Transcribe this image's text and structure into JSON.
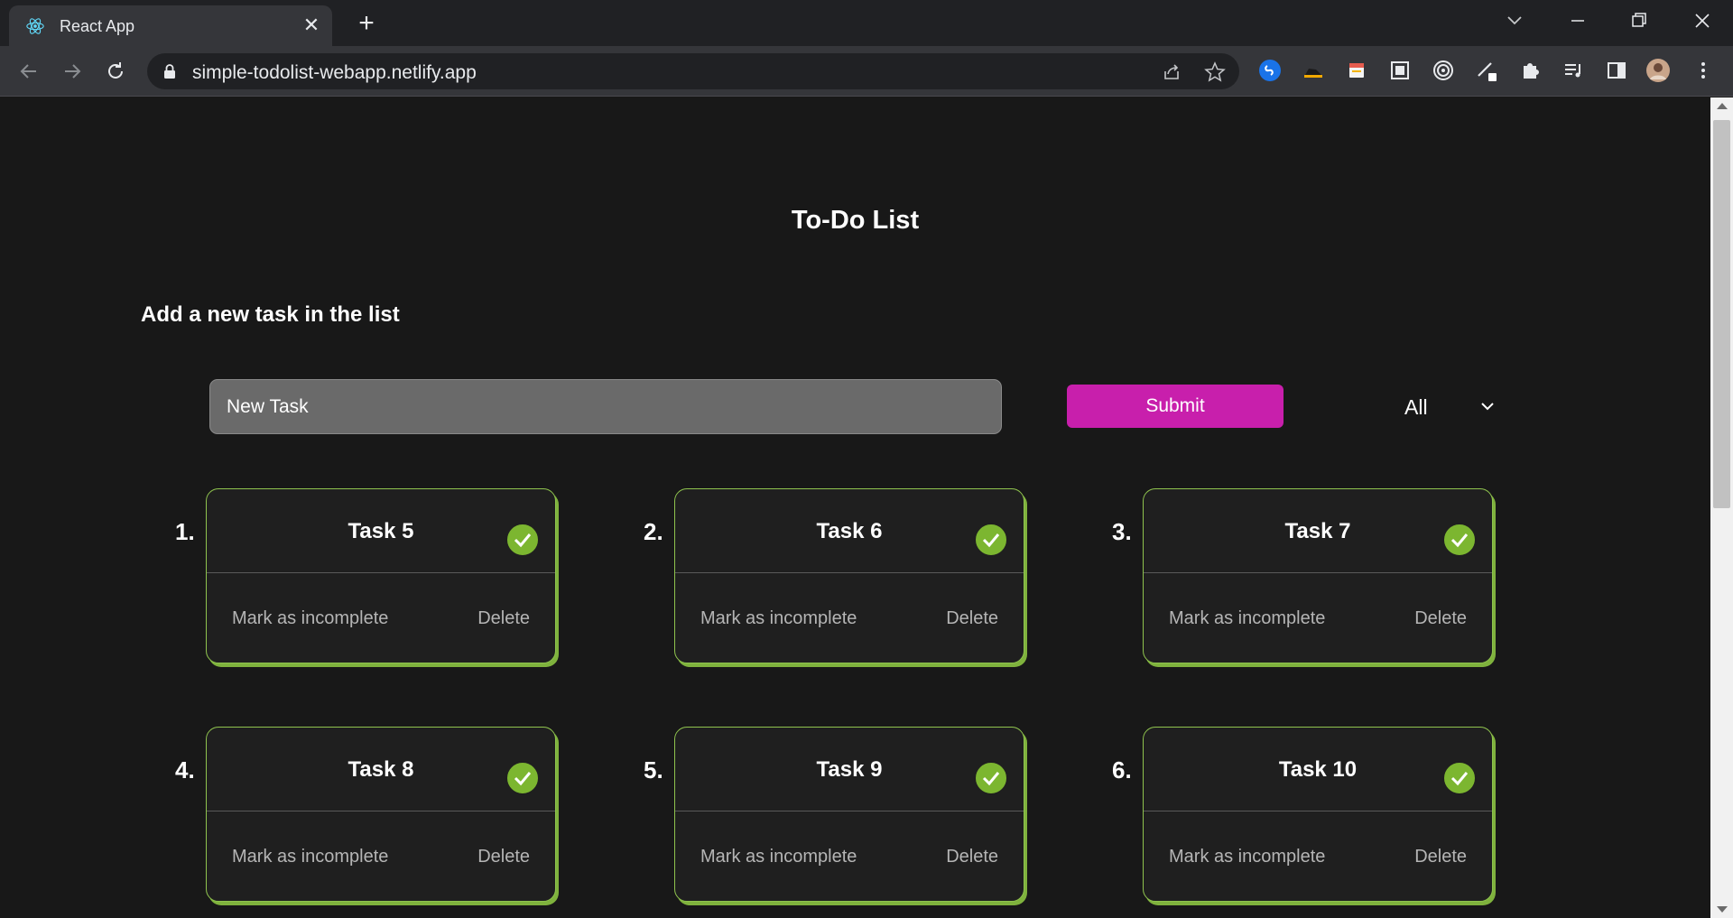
{
  "browser": {
    "tab_title": "React App",
    "url": "simple-todolist-webapp.netlify.app"
  },
  "page": {
    "title": "To-Do List",
    "section_heading": "Add a new task in the list",
    "input_value": "New Task",
    "submit_label": "Submit",
    "filter_value": "All"
  },
  "tasks": [
    {
      "number": "1.",
      "title": "Task 5",
      "mark_label": "Mark as incomplete",
      "delete_label": "Delete"
    },
    {
      "number": "2.",
      "title": "Task 6",
      "mark_label": "Mark as incomplete",
      "delete_label": "Delete"
    },
    {
      "number": "3.",
      "title": "Task 7",
      "mark_label": "Mark as incomplete",
      "delete_label": "Delete"
    },
    {
      "number": "4.",
      "title": "Task 8",
      "mark_label": "Mark as incomplete",
      "delete_label": "Delete"
    },
    {
      "number": "5.",
      "title": "Task 9",
      "mark_label": "Mark as incomplete",
      "delete_label": "Delete"
    },
    {
      "number": "6.",
      "title": "Task 10",
      "mark_label": "Mark as incomplete",
      "delete_label": "Delete"
    }
  ],
  "colors": {
    "accent_submit": "#c81fac",
    "completed_green": "#7cb630",
    "background": "#181818"
  }
}
